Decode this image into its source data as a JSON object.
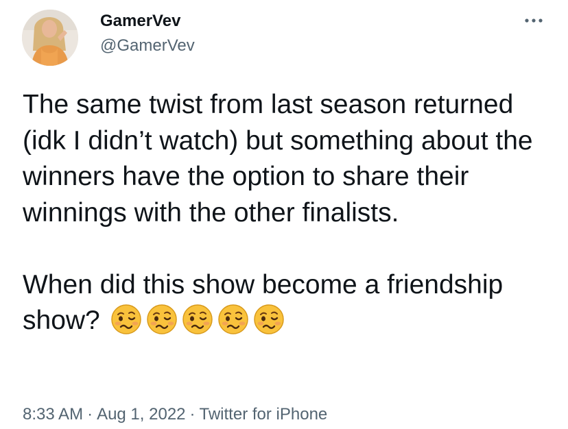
{
  "tweet": {
    "author": {
      "display_name": "GamerVev",
      "handle": "@GamerVev",
      "avatar_icon": "profile-photo"
    },
    "more_icon": "more-horizontal-icon",
    "paragraphs": [
      "The same twist from last season returned (idk I didn’t watch) but something about the winners have the option to share their winnings with the other finalists.",
      "When did this show become a friendship show?"
    ],
    "emoji": {
      "name": "woozy-face",
      "count": 5
    },
    "meta": {
      "time": "8:33 AM",
      "separator": "·",
      "date": "Aug 1, 2022",
      "source": "Twitter for iPhone"
    }
  },
  "colors": {
    "text_primary": "#0f1419",
    "text_secondary": "#536471",
    "emoji_face": "#f9c23c"
  }
}
